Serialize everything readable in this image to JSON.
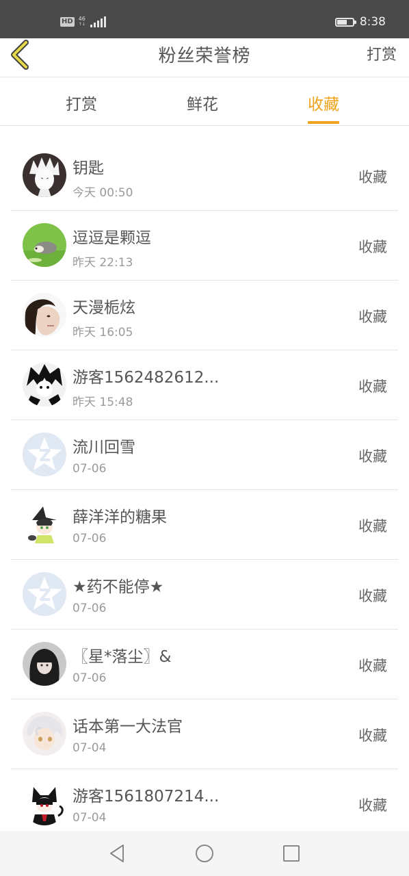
{
  "status_bar": {
    "hd": "HD",
    "network_top": "46",
    "network_bottom": "↑↓",
    "time": "8:38",
    "battery_level": 0.65
  },
  "header": {
    "title": "粉丝荣誉榜",
    "action_label": "打赏",
    "back_icon": "chevron-left-icon"
  },
  "tabs": [
    {
      "label": "打赏",
      "active": false
    },
    {
      "label": "鲜花",
      "active": false
    },
    {
      "label": "收藏",
      "active": true
    }
  ],
  "accent_color": "#f0a31c",
  "list": [
    {
      "name": "钥匙",
      "time": "今天 00:50",
      "kind": "收藏",
      "avatar": "anime-boy-avatar"
    },
    {
      "name": "逗逗是颗逗",
      "time": "昨天 22:13",
      "kind": "收藏",
      "avatar": "hedgehog-on-grass-avatar"
    },
    {
      "name": "天漫栀炫",
      "time": "昨天 16:05",
      "kind": "收藏",
      "avatar": "woman-portrait-avatar"
    },
    {
      "name": "游客1562482612...",
      "time": "昨天 15:48",
      "kind": "收藏",
      "avatar": "manga-boy-avatar"
    },
    {
      "name": "流川回雪",
      "time": "07-06",
      "kind": "收藏",
      "avatar": "default-qq-avatar"
    },
    {
      "name": "薛洋洋的糖果",
      "time": "07-06",
      "kind": "收藏",
      "avatar": "chibi-witch-avatar"
    },
    {
      "name": "★药不能停★",
      "time": "07-06",
      "kind": "收藏",
      "avatar": "default-qq-avatar"
    },
    {
      "name": "〖星*落尘〗&",
      "time": "07-06",
      "kind": "收藏",
      "avatar": "dark-hair-girl-avatar"
    },
    {
      "name": "话本第一大法官",
      "time": "07-04",
      "kind": "收藏",
      "avatar": "white-hair-boy-avatar"
    },
    {
      "name": "游客1561807214...",
      "time": "07-04",
      "kind": "收藏",
      "avatar": "black-cat-girl-avatar"
    }
  ],
  "nav": {
    "back": "nav-back-icon",
    "home": "nav-home-icon",
    "recents": "nav-recents-icon"
  }
}
